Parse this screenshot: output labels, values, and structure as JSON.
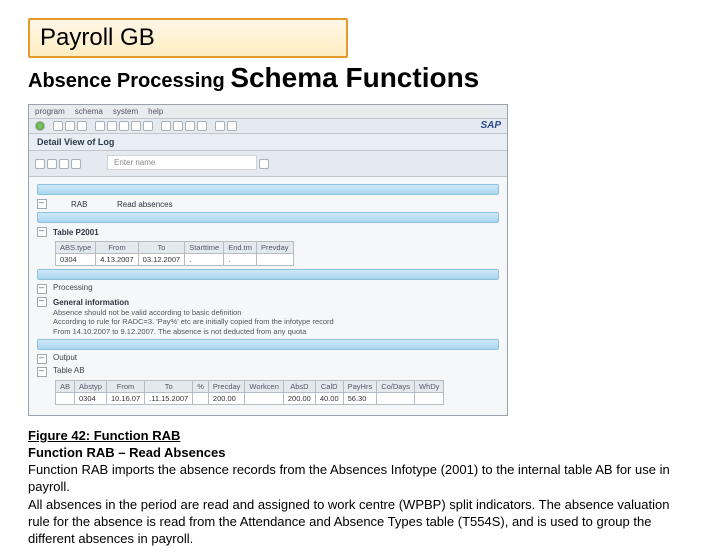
{
  "title_box": "Payroll GB",
  "subtitle_pre": "Absence Processing ",
  "subtitle_big": "Schema Functions",
  "sap": {
    "menu": [
      "program",
      "schema",
      "system",
      "help"
    ],
    "header": "Detail View of Log",
    "hint": "Enter   name",
    "func_code": "RAB",
    "func_desc": "Read absences",
    "table_head": "Table P2001",
    "p2001": {
      "cols": [
        "ABS.type",
        "From",
        "To",
        "Starttime",
        "End.tm",
        "Prevday"
      ],
      "row": [
        "0304",
        "4.13.2007",
        "03.12.2007",
        ".",
        ".",
        ""
      ]
    },
    "processing_label": "Processing",
    "proc_head": "General information",
    "proc_lines": [
      "Absence should not be valid according to basic definition",
      "According to rule for   RADC=3. 'Pay%' etc are initially copied from the infotype record",
      "From 14.10.2007 to  9.12.2007. The absence is not deducted from any quota"
    ],
    "output_label": "Output",
    "table_ab_label": "Table AB",
    "ab": {
      "cols": [
        "AB",
        "Abstyp",
        "From",
        "To",
        "%",
        "Precday",
        "Workcen",
        "AbsD",
        "CalD",
        "PayHrs",
        "Co/Days",
        "WhDy"
      ],
      "row": [
        "",
        "0304",
        "10.16.07",
        ".11.15.2007",
        "",
        "200.00",
        "",
        "200.00",
        "40.00",
        "56.30",
        "",
        ""
      ]
    },
    "logo": "SAP"
  },
  "caption": "Figure 42: Function RAB",
  "para_head": "Function RAB – Read Absences",
  "para1": "Function RAB imports the absence records from the Absences Infotype (2001) to the internal table AB for use in payroll.",
  "para2": "All absences in the period are read and assigned to work centre (WPBP) split indicators. The absence valuation rule for the absence is read from the Attendance and Absence Types table (T554S), and is used to group the different absences in payroll."
}
